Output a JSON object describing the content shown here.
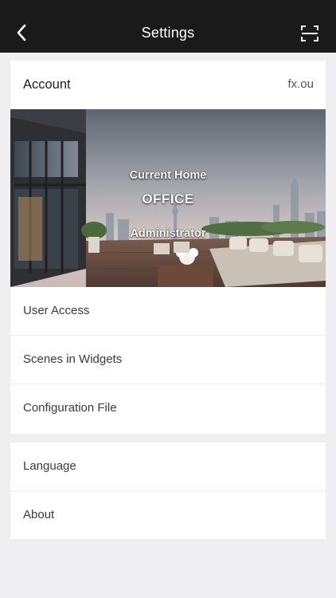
{
  "nav": {
    "title": "Settings",
    "back_icon": "chevron-left-icon",
    "scan_icon": "scan-icon"
  },
  "account": {
    "label": "Account",
    "value": "fx.ou"
  },
  "home": {
    "subtitle": "Current Home",
    "name": "OFFICE",
    "role": "Administrator"
  },
  "menu": {
    "items": [
      {
        "label": "User Access"
      },
      {
        "label": "Scenes in Widgets"
      },
      {
        "label": "Configuration File"
      }
    ]
  },
  "menu2": {
    "items": [
      {
        "label": "Language"
      },
      {
        "label": "About"
      }
    ]
  },
  "colors": {
    "nav_bg": "#1a1a1a",
    "page_bg": "#efeff1",
    "card_bg": "#ffffff"
  }
}
